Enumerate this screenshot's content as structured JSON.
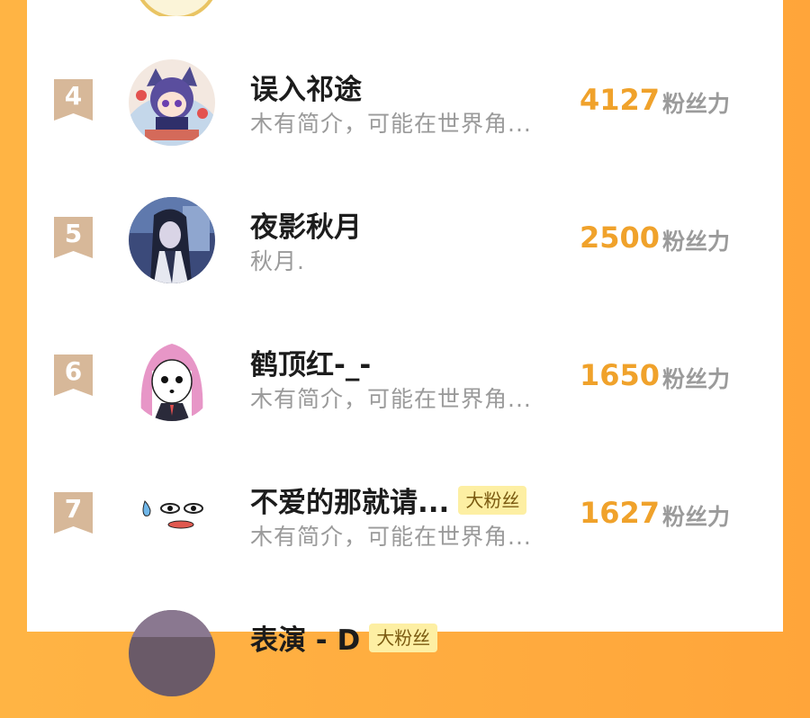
{
  "colors": {
    "background": "#ffad40",
    "panel": "#ffffff",
    "rank_badge": "#d7b899",
    "score": "#f0a22b",
    "badge_bg": "#fdefa3"
  },
  "unit_label": "粉丝力",
  "rows": [
    {
      "rank": "4",
      "name": "误入祁途",
      "bio": "木有简介，可能在世界角...",
      "score": "4127",
      "badge": ""
    },
    {
      "rank": "5",
      "name": "夜影秋月",
      "bio": "秋月.",
      "score": "2500",
      "badge": ""
    },
    {
      "rank": "6",
      "name": "鹤顶红-_-",
      "bio": "木有简介，可能在世界角...",
      "score": "1650",
      "badge": ""
    },
    {
      "rank": "7",
      "name": "不爱的那就请...",
      "bio": "木有简介，可能在世界角...",
      "score": "1627",
      "badge": "大粉丝"
    },
    {
      "rank": "",
      "name": "表演 - D",
      "bio": "",
      "score": "",
      "badge": "大粉丝"
    }
  ]
}
